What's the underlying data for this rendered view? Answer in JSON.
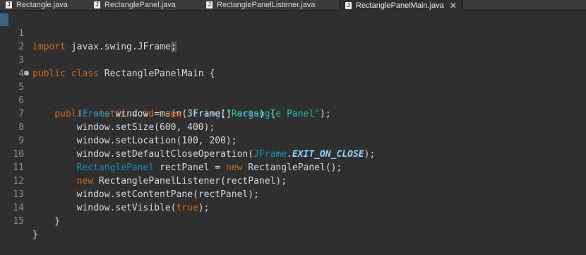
{
  "tabs": [
    {
      "label": "Rectangle.java"
    },
    {
      "label": "RectanglePanel.java"
    },
    {
      "label": "RectanglePanelListener.java"
    },
    {
      "label": "RectanglePanelMain.java"
    }
  ],
  "code": {
    "line_numbers": [
      "1",
      "2",
      "3",
      "4",
      "5",
      "6",
      "7",
      "8",
      "9",
      "10",
      "11",
      "12",
      "13",
      "14",
      "15"
    ],
    "l1": {
      "kw": "import",
      "rest": " javax.swing.JFrame",
      "semi": ";"
    },
    "l3": {
      "kw1": "public",
      "kw2": " class",
      "rest": " RectanglePanelMain {"
    },
    "l5": {
      "indent": "    ",
      "kw1": "public",
      "kw2": " static",
      "kw3": " void",
      "p1": " main(",
      "type": "String",
      "p2": "[] ",
      "arg": "args",
      "p3": ") {"
    },
    "l6": {
      "indent": "        ",
      "type": "JFrame",
      "p1": " window = ",
      "kw": "new",
      "p2": " JFrame(",
      "str": "\"Rectangle Panel\"",
      "p3": ");"
    },
    "l7": {
      "text": "        window.setSize(600, 400);"
    },
    "l8": {
      "text": "        window.setLocation(100, 200);"
    },
    "l9": {
      "p1": "        window.setDefaultCloseOperation(",
      "type": "JFrame",
      "dot": ".",
      "field": "EXIT_ON_CLOSE",
      "p2": ");"
    },
    "l10": {
      "indent": "        ",
      "type": "RectanglePanel",
      "p1": " rectPanel = ",
      "kw": "new",
      "p2": " RectanglePanel();"
    },
    "l11": {
      "indent": "        ",
      "kw": "new",
      "p1": " RectanglePanelListener(rectPanel);"
    },
    "l12": {
      "text": "        window.setContentPane(rectPanel);"
    },
    "l13": {
      "p1": "        window.setVisible(",
      "kw": "true",
      "p2": ");"
    },
    "l14": {
      "text": "    }"
    },
    "l15": {
      "text": "}"
    }
  }
}
